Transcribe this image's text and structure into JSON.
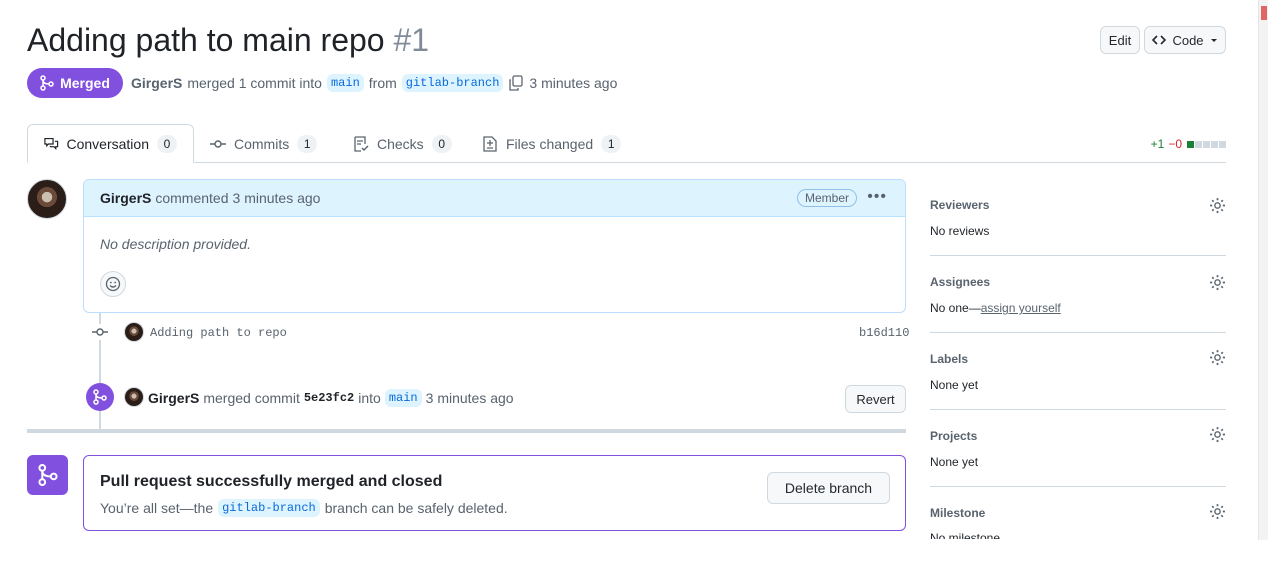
{
  "header": {
    "title": "Adding path to main repo",
    "number": "#1",
    "edit_label": "Edit",
    "code_label": "Code",
    "code_icon": "code-icon"
  },
  "status": {
    "badge_label": "Merged",
    "author": "GirgerS",
    "merged_text": "merged 1 commit into",
    "base_branch": "main",
    "from_text": "from",
    "head_branch": "gitlab-branch",
    "time": "3 minutes ago"
  },
  "tabs": [
    {
      "label": "Conversation",
      "count": "0",
      "icon": "comment-discussion-icon"
    },
    {
      "label": "Commits",
      "count": "1",
      "icon": "commit-icon"
    },
    {
      "label": "Checks",
      "count": "0",
      "icon": "checklist-icon"
    },
    {
      "label": "Files changed",
      "count": "1",
      "icon": "file-diff-icon"
    }
  ],
  "diffstat": {
    "additions": "+1",
    "deletions": "−0",
    "colors": {
      "add": "#1a7f37",
      "neutral": "#d1d9e0"
    }
  },
  "comment": {
    "author": "GirgerS",
    "action": "commented",
    "time": "3 minutes ago",
    "role": "Member",
    "body": "No description provided."
  },
  "commit": {
    "message": "Adding path to repo",
    "sha": "b16d110"
  },
  "merge_event": {
    "author": "GirgerS",
    "text1": "merged commit",
    "sha": "5e23fc2",
    "text2": "into",
    "branch": "main",
    "time": "3 minutes ago",
    "revert_label": "Revert"
  },
  "merged_box": {
    "title": "Pull request successfully merged and closed",
    "desc_prefix": "You’re all set—the",
    "branch": "gitlab-branch",
    "desc_suffix": "branch can be safely deleted.",
    "delete_label": "Delete branch"
  },
  "sidebar": {
    "reviewers": {
      "title": "Reviewers",
      "value": "No reviews"
    },
    "assignees": {
      "title": "Assignees",
      "value_prefix": "No one—",
      "link": "assign yourself"
    },
    "labels": {
      "title": "Labels",
      "value": "None yet"
    },
    "projects": {
      "title": "Projects",
      "value": "None yet"
    },
    "milestone": {
      "title": "Milestone",
      "value": "No milestone"
    }
  },
  "colors": {
    "accent_merged": "#8250df",
    "link": "#0969da",
    "comment_header": "#ddf4ff"
  }
}
